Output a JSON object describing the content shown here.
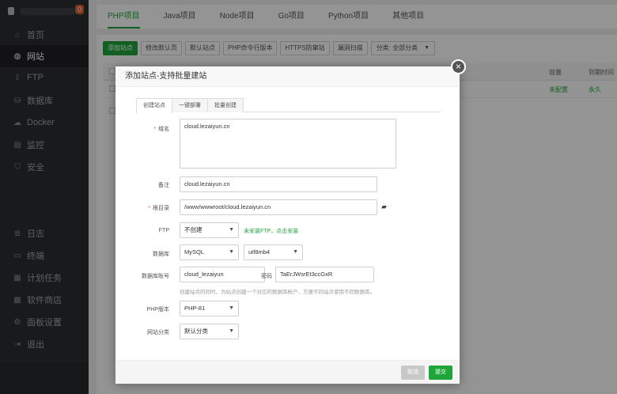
{
  "sidebar": {
    "badge": "0",
    "items": [
      {
        "label": "首页",
        "icon": "home-icon",
        "glyph": "⌂"
      },
      {
        "label": "网站",
        "icon": "globe-icon",
        "glyph": "◍"
      },
      {
        "label": "FTP",
        "icon": "ftp-icon",
        "glyph": "⇪"
      },
      {
        "label": "数据库",
        "icon": "database-icon",
        "glyph": "⛁"
      },
      {
        "label": "Docker",
        "icon": "docker-icon",
        "glyph": "☁"
      },
      {
        "label": "监控",
        "icon": "monitor-icon",
        "glyph": "▤"
      },
      {
        "label": "安全",
        "icon": "shield-icon",
        "glyph": "⛉"
      },
      {
        "label": "日志",
        "icon": "log-icon",
        "glyph": "≣"
      },
      {
        "label": "终端",
        "icon": "terminal-icon",
        "glyph": "▭"
      },
      {
        "label": "计划任务",
        "icon": "calendar-icon",
        "glyph": "▦"
      },
      {
        "label": "软件商店",
        "icon": "apps-icon",
        "glyph": "▩"
      },
      {
        "label": "面板设置",
        "icon": "gear-icon",
        "glyph": "⚙"
      },
      {
        "label": "退出",
        "icon": "logout-icon",
        "glyph": "⇥"
      }
    ]
  },
  "top_tabs": [
    "PHP项目",
    "Java项目",
    "Node项目",
    "Go项目",
    "Python项目",
    "其他项目"
  ],
  "toolbar": {
    "add_site": "添加站点",
    "edit_default": "修改默认页",
    "default_site": "默认站点",
    "php_cli": "PHP命令行版本",
    "https_protect": "HTTPS防窜站",
    "vuln_scan": "漏洞扫描",
    "category": "分类: 全部分类"
  },
  "table": {
    "col_capacity": "容量",
    "col_expire": "到期时间",
    "row_capacity": "未配置",
    "row_expire": "永久"
  },
  "modal": {
    "title": "添加站点-支持批量建站",
    "tabs": [
      "创建站点",
      "一键部署",
      "批量创建"
    ],
    "domain_label": "域名",
    "domain_value": "cloud.lezaiyun.cn",
    "remark_label": "备注",
    "remark_value": "cloud.lezaiyun.cn",
    "root_label": "根目录",
    "root_value": "/www/wwwroot/cloud.lezaiyun.cn",
    "ftp_label": "FTP",
    "ftp_value": "不创建",
    "ftp_hint": "未安装FTP，点击安装",
    "db_label": "数据库",
    "db_value": "MySQL",
    "charset_value": "utf8mb4",
    "db_account_label": "数据库账号",
    "db_account_value": "cloud_lezaiyun",
    "password_label": "密码",
    "password_value": "TaErJWsrEt3ccGxR",
    "db_hint": "创建站点的同时，为站点创建一个对应的数据库帐户，方便不同站点使用不同数据库。",
    "php_label": "PHP版本",
    "php_value": "PHP-81",
    "category_label": "网站分类",
    "category_value": "默认分类",
    "cancel": "取消",
    "submit": "提交"
  }
}
